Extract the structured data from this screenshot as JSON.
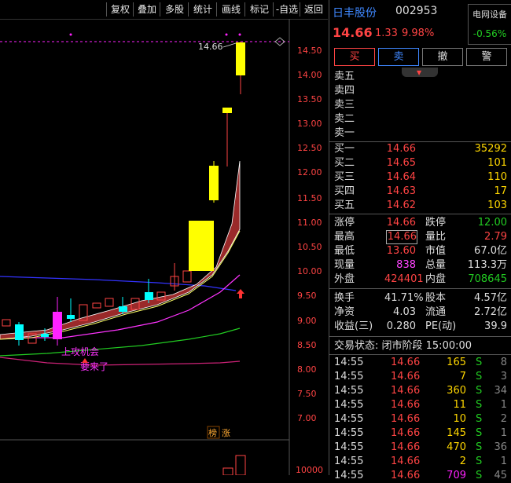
{
  "toolbar": {
    "buttons": [
      "复权",
      "叠加",
      "多股",
      "统计",
      "画线",
      "标记",
      "-自选",
      "返回"
    ]
  },
  "chart": {
    "price_labels": [
      "14.50",
      "14.00",
      "13.50",
      "13.00",
      "12.50",
      "12.00",
      "11.50",
      "11.00",
      "10.50",
      "10.00",
      "9.50",
      "9.00",
      "8.50",
      "8.00",
      "7.50",
      "7.00"
    ],
    "high_label": "14.66",
    "annot_opportunity": "上攻机会",
    "annot_coming": "要来了",
    "badge_1": "榜",
    "badge_2": "涨",
    "volume_label": "10000",
    "colors": {
      "up": "#ffff00",
      "down": "#00ffff",
      "magenta": "#ff22ff",
      "axis_text": "#ff4444"
    }
  },
  "header": {
    "name": "日丰股份",
    "code": "002953",
    "sector": "电网设备",
    "sector_change": "-0.56%",
    "price": "14.66",
    "change": "1.33",
    "change_pct": "9.98%"
  },
  "actions": [
    "买",
    "卖",
    "撤",
    "警"
  ],
  "asks": [
    {
      "label": "卖五",
      "price": "",
      "vol": ""
    },
    {
      "label": "卖四",
      "price": "",
      "vol": ""
    },
    {
      "label": "卖三",
      "price": "",
      "vol": ""
    },
    {
      "label": "卖二",
      "price": "",
      "vol": ""
    },
    {
      "label": "卖一",
      "price": "",
      "vol": ""
    }
  ],
  "bids": [
    {
      "label": "买一",
      "price": "14.66",
      "vol": "35292"
    },
    {
      "label": "买二",
      "price": "14.65",
      "vol": "101"
    },
    {
      "label": "买三",
      "price": "14.64",
      "vol": "110"
    },
    {
      "label": "买四",
      "price": "14.63",
      "vol": "17"
    },
    {
      "label": "买五",
      "price": "14.62",
      "vol": "103"
    }
  ],
  "quote": {
    "limit_up_label": "涨停",
    "limit_up": "14.66",
    "limit_down_label": "跌停",
    "limit_down": "12.00",
    "high_label": "最高",
    "high": "14.66",
    "vol_ratio_label": "量比",
    "vol_ratio": "2.79",
    "low_label": "最低",
    "low": "13.60",
    "mkt_cap_label": "市值",
    "mkt_cap": "67.0亿",
    "last_vol_label": "现量",
    "last_vol": "838",
    "total_vol_label": "总量",
    "total_vol": "113.3万",
    "outer_label": "外盘",
    "outer": "424401",
    "inner_label": "内盘",
    "inner": "708645",
    "turnover_label": "换手",
    "turnover": "41.71%",
    "equity_label": "股本",
    "equity": "4.57亿",
    "nav_label": "净资",
    "nav": "4.03",
    "float_label": "流通",
    "float": "2.72亿",
    "eps_label": "收益(三)",
    "eps": "0.280",
    "pe_label": "PE(动)",
    "pe": "39.9"
  },
  "status": "交易状态: 闭市阶段 15:00:00",
  "ticks": [
    {
      "time": "14:55",
      "price": "14.66",
      "vol": "165",
      "side": "S",
      "n": "8"
    },
    {
      "time": "14:55",
      "price": "14.66",
      "vol": "7",
      "side": "S",
      "n": "3"
    },
    {
      "time": "14:55",
      "price": "14.66",
      "vol": "360",
      "side": "S",
      "n": "34"
    },
    {
      "time": "14:55",
      "price": "14.66",
      "vol": "11",
      "side": "S",
      "n": "1"
    },
    {
      "time": "14:55",
      "price": "14.66",
      "vol": "10",
      "side": "S",
      "n": "2"
    },
    {
      "time": "14:55",
      "price": "14.66",
      "vol": "145",
      "side": "S",
      "n": "1"
    },
    {
      "time": "14:55",
      "price": "14.66",
      "vol": "470",
      "side": "S",
      "n": "36"
    },
    {
      "time": "14:55",
      "price": "14.66",
      "vol": "2",
      "side": "S",
      "n": "1"
    },
    {
      "time": "14:55",
      "price": "14.66",
      "vol": "709",
      "side": "S",
      "n": "45"
    }
  ]
}
